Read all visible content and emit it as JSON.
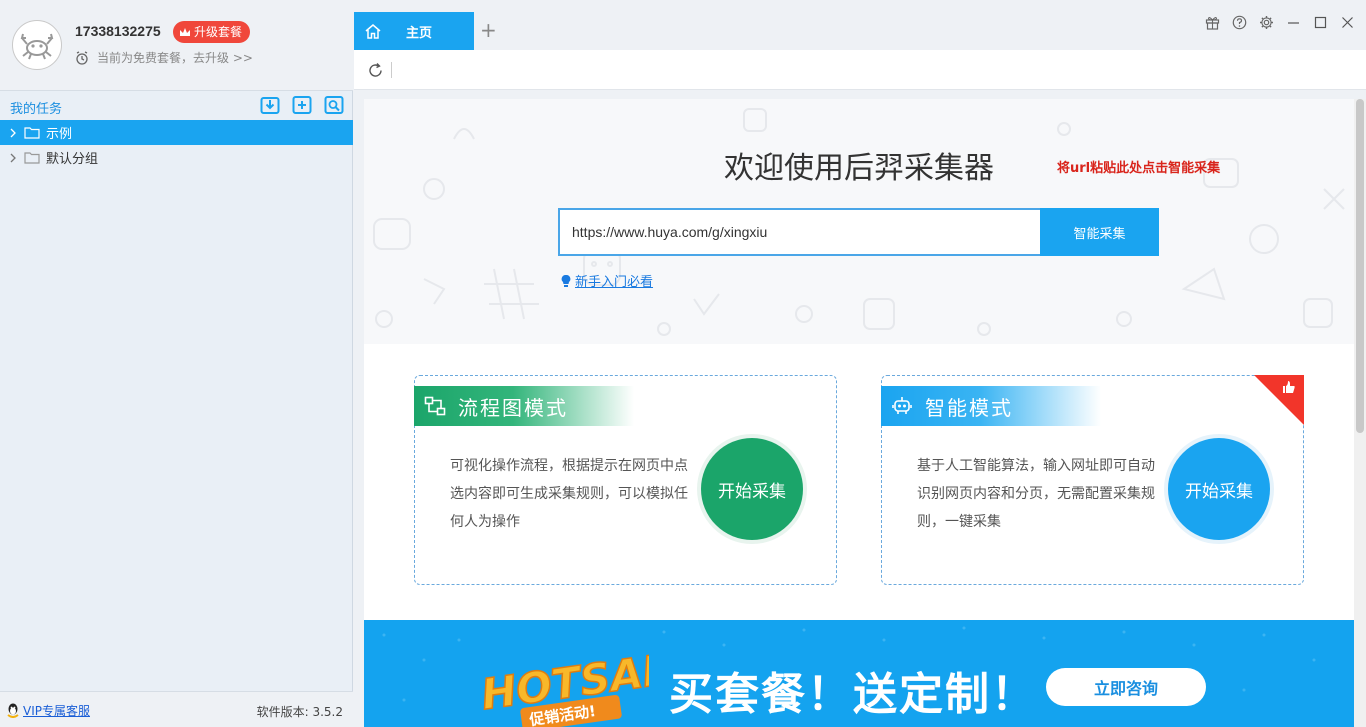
{
  "user": {
    "phone": "17338132275",
    "upgrade_label": "升级套餐",
    "plan_text": "当前为免费套餐，去升级 >>"
  },
  "tasks": {
    "title": "我的任务",
    "items": [
      {
        "label": "示例",
        "active": true
      },
      {
        "label": "默认分组",
        "active": false
      }
    ]
  },
  "footer": {
    "vip_label": "VIP专属客服",
    "version_text": "软件版本: 3.5.2"
  },
  "tabs": {
    "home_label": "主页",
    "add_label": "+"
  },
  "hero": {
    "welcome": "欢迎使用后羿采集器",
    "annotation": "将url粘贴此处点击智能采集",
    "url_value": "https://www.huya.com/g/xingxiu",
    "smart_button": "智能采集",
    "beginner_link": "新手入门必看"
  },
  "cards": {
    "flow": {
      "title": "流程图模式",
      "desc": "可视化操作流程，根据提示在网页中点选内容即可生成采集规则，可以模拟任何人为操作",
      "button": "开始采集"
    },
    "smart": {
      "title": "智能模式",
      "desc": "基于人工智能算法，输入网址即可自动识别网页内容和分页，无需配置采集规则，一键采集",
      "button": "开始采集"
    }
  },
  "promo": {
    "hot_text": "HOTSALE",
    "hot_sub": "促销活动!",
    "headline": "买套餐！送定制！",
    "button": "立即咨询"
  },
  "colors": {
    "accent": "#1aa4f0",
    "green": "#1ba56a",
    "red": "#f0473b",
    "annotation": "#d9251c"
  }
}
